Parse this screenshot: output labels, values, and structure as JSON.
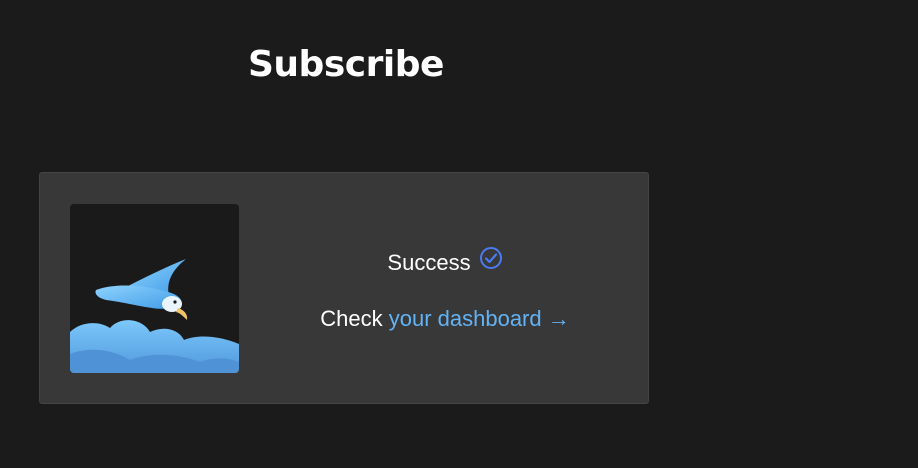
{
  "page": {
    "title": "Subscribe"
  },
  "status": {
    "success_text": "Success",
    "check_prefix": "Check",
    "dashboard_link_text": "your dashboard →"
  },
  "icons": {
    "status": "check-circle-icon",
    "logo": "bird-over-clouds-logo"
  },
  "colors": {
    "background": "#1b1b1c",
    "card": "#383838",
    "link": "#62b3f5",
    "check": "#4a7bf0"
  }
}
